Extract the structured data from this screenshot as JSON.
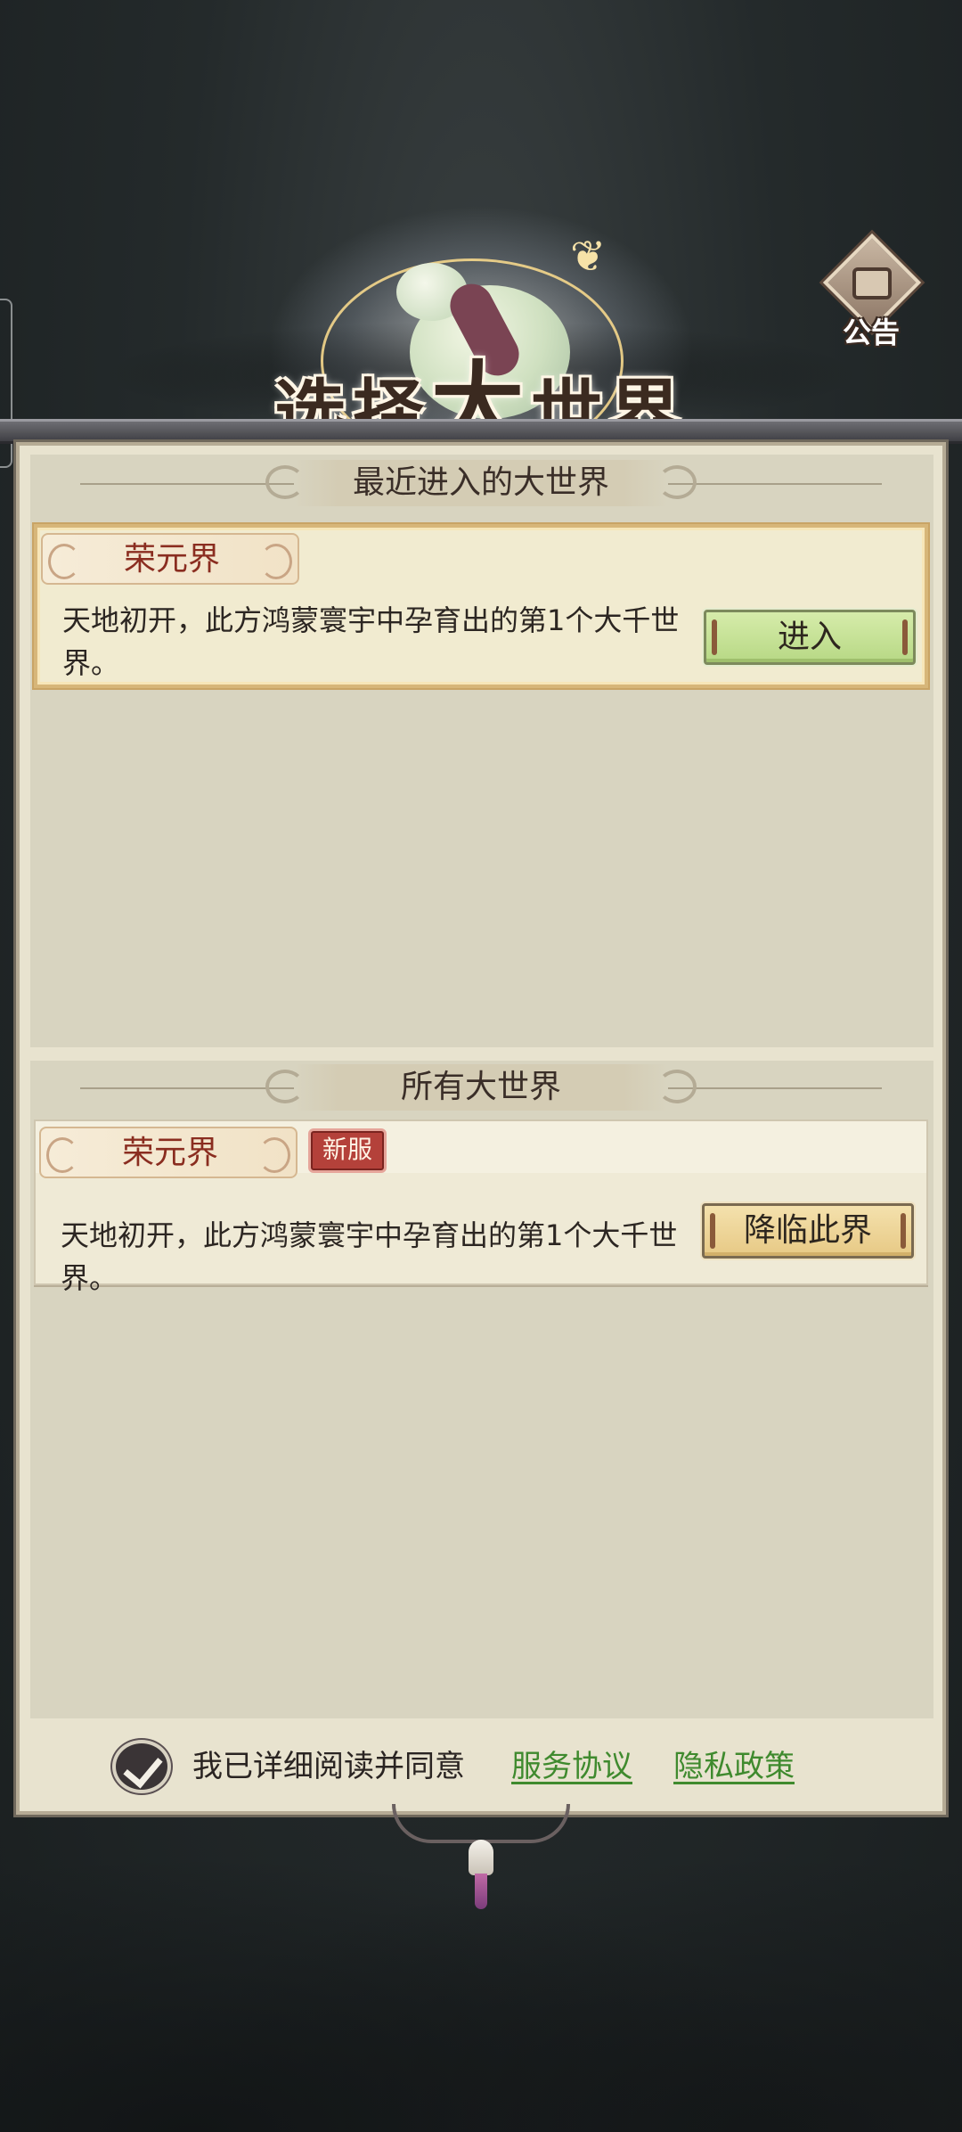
{
  "header": {
    "title_small_1": "选择",
    "title_big": "大",
    "title_small_2": "世界",
    "notice_label": "公告"
  },
  "recent": {
    "section_title": "最近进入的大世界",
    "servers": [
      {
        "name": "荣元界",
        "description": "天地初开，此方鸿蒙寰宇中孕育出的第1个大千世界。",
        "button_label": "进入"
      }
    ]
  },
  "all": {
    "section_title": "所有大世界",
    "servers": [
      {
        "name": "荣元界",
        "badge": "新服",
        "description": "天地初开，此方鸿蒙寰宇中孕育出的第1个大千世界。",
        "button_label": "降临此界"
      }
    ]
  },
  "agreement": {
    "checked": true,
    "text": "我已详细阅读并同意",
    "service_link": "服务协议",
    "privacy_link": "隐私政策"
  },
  "colors": {
    "panel_bg": "#e8e3cf",
    "enter_button": "#c4e096",
    "descend_button": "#ecd392",
    "link_green": "#3f8a2e",
    "new_badge": "#b4413a"
  }
}
